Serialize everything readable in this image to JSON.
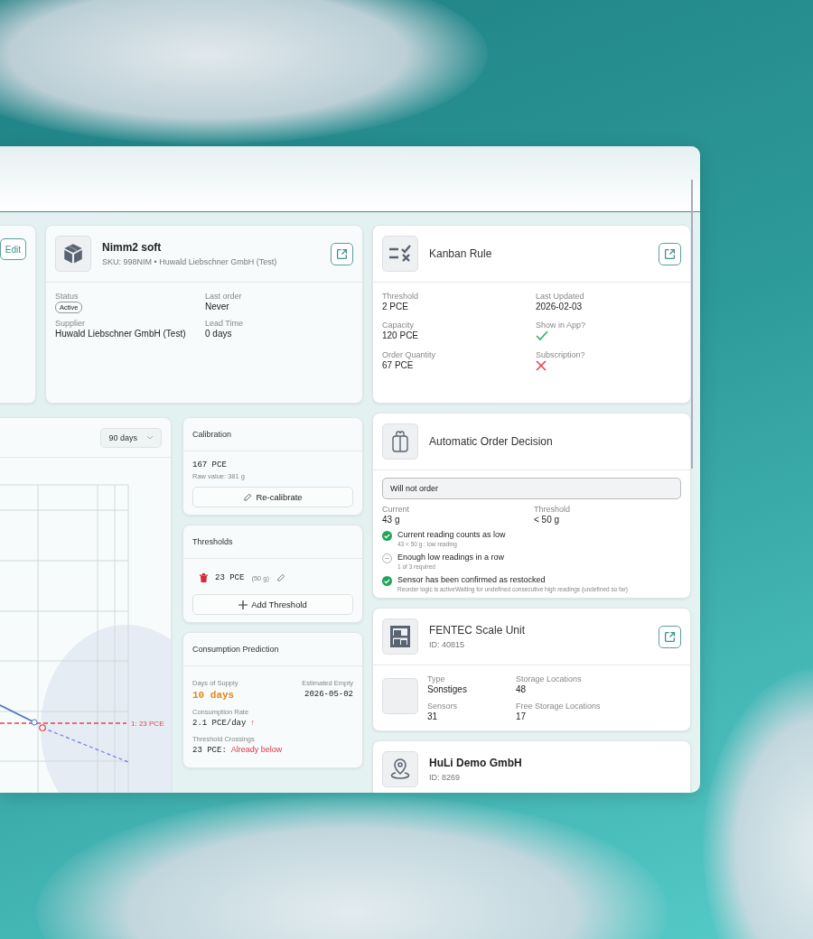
{
  "edit_button": "Edit",
  "product": {
    "name": "Nimm2 soft",
    "subtitle": "SKU: 998NIM • Huwald Liebschner GmbH (Test)",
    "fields": [
      {
        "label": "Status",
        "value": "Active",
        "kind": "badge"
      },
      {
        "label": "Last order",
        "value": "Never",
        "kind": "text"
      },
      {
        "label": "Supplier",
        "value": "Huwald Liebschner GmbH (Test)",
        "kind": "text"
      },
      {
        "label": "Lead Time",
        "value": "0 days",
        "kind": "text"
      }
    ]
  },
  "chart": {
    "range": "90 days",
    "threshold_label": "1: 23 PCE"
  },
  "calibration": {
    "title": "Calibration",
    "value": "167 PCE",
    "raw": "Raw value: 381 g",
    "button": "Re-calibrate"
  },
  "thresholds": {
    "title": "Thresholds",
    "items": [
      {
        "value": "23 PCE",
        "weight": "(50 g)"
      }
    ],
    "add_button": "Add Threshold"
  },
  "prediction": {
    "title": "Consumption Prediction",
    "days_label": "Days of Supply",
    "days": "10 days",
    "empty_label": "Estimated Empty",
    "empty": "2026-05-02",
    "rate_label": "Consumption Rate",
    "rate": "2.1 PCE/day",
    "rate_trend": "↑",
    "crossings_label": "Threshold Crossings",
    "crossings": [
      {
        "value": "23 PCE:",
        "status": "Already below"
      }
    ]
  },
  "kanban": {
    "title": "Kanban Rule",
    "fields": [
      {
        "label": "Threshold",
        "value": "2 PCE",
        "kind": "text"
      },
      {
        "label": "Last Updated",
        "value": "2026-02-03",
        "kind": "text"
      },
      {
        "label": "Capacity",
        "value": "120 PCE",
        "kind": "text"
      },
      {
        "label": "Show in App?",
        "kind": "flag",
        "on": true
      },
      {
        "label": "Order Quantity",
        "value": "67 PCE",
        "kind": "text"
      },
      {
        "label": "Subscription?",
        "kind": "flag",
        "on": false
      }
    ]
  },
  "decision": {
    "title": "Automatic Order Decision",
    "verdict": "Will not order",
    "current_label": "Current",
    "current": "43 g",
    "threshold_label": "Threshold",
    "threshold": "< 50 g",
    "conditions": [
      {
        "title": "Current reading counts as low",
        "detail": "43 < 50 g : low reading",
        "met": true
      },
      {
        "title": "Enough low readings in a row",
        "detail": "1 of 3 required",
        "met": false
      },
      {
        "title": "Sensor has been confirmed as restocked",
        "detail": "Reorder logic is activeWaiting for undefined consecutive high readings (undefined so far)",
        "met": true
      }
    ]
  },
  "scale": {
    "name": "FENTEC Scale Unit",
    "id": "ID: 40815",
    "fields": [
      {
        "label": "Type",
        "value": "Sonstiges"
      },
      {
        "label": "Storage Locations",
        "value": "48"
      },
      {
        "label": "Sensors",
        "value": "31"
      },
      {
        "label": "Free Storage Locations",
        "value": "17"
      }
    ]
  },
  "location": {
    "name": "HuLi Demo GmbH",
    "id": "ID: 8269"
  }
}
